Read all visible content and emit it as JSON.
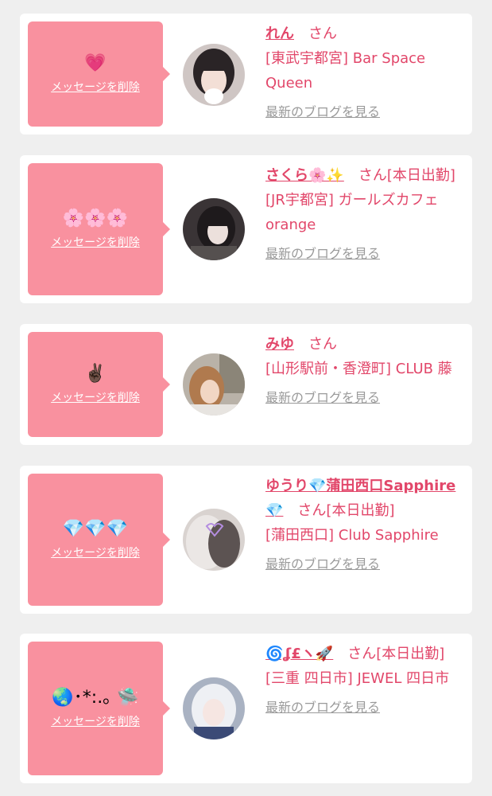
{
  "delete_label": "メッセージを削除",
  "blog_label": "最新のブログを見る",
  "san_label": "さん",
  "colors": {
    "accent": "#e2476a",
    "message_box": "#f9919f",
    "muted": "#9a9a9a"
  },
  "cards": [
    {
      "emoji": "💗",
      "name": "れん",
      "suffix": "",
      "shop": "[東武宇都宮] Bar Space Queen",
      "avatar_icon": "avatar-woman-dark-hair"
    },
    {
      "emoji": "🌸🌸🌸",
      "name": "さくら🌸✨",
      "suffix": "[本日出勤]",
      "shop": "[JR宇都宮] ガールズカフェorange",
      "avatar_icon": "avatar-woman-dark-hair"
    },
    {
      "emoji": "✌🏿",
      "name": "みゆ",
      "suffix": "",
      "shop": "[山形駅前・香澄町] CLUB 藤",
      "avatar_icon": "avatar-woman-brown-hair"
    },
    {
      "emoji": "💎💎💎",
      "name": "ゆうり💎蒲田西口Sapphire💎",
      "suffix": "[本日出勤]",
      "shop": "[蒲田西口] Club Sapphire",
      "avatar_icon": "avatar-woman-blurred"
    },
    {
      "emoji": "🌏･*:.｡ 🛸",
      "name": "🌀ʆ£ヽ🚀",
      "suffix": "[本日出勤]",
      "shop": "[三重 四日市] JEWEL 四日市",
      "avatar_icon": "avatar-woman-silver-hair"
    }
  ]
}
